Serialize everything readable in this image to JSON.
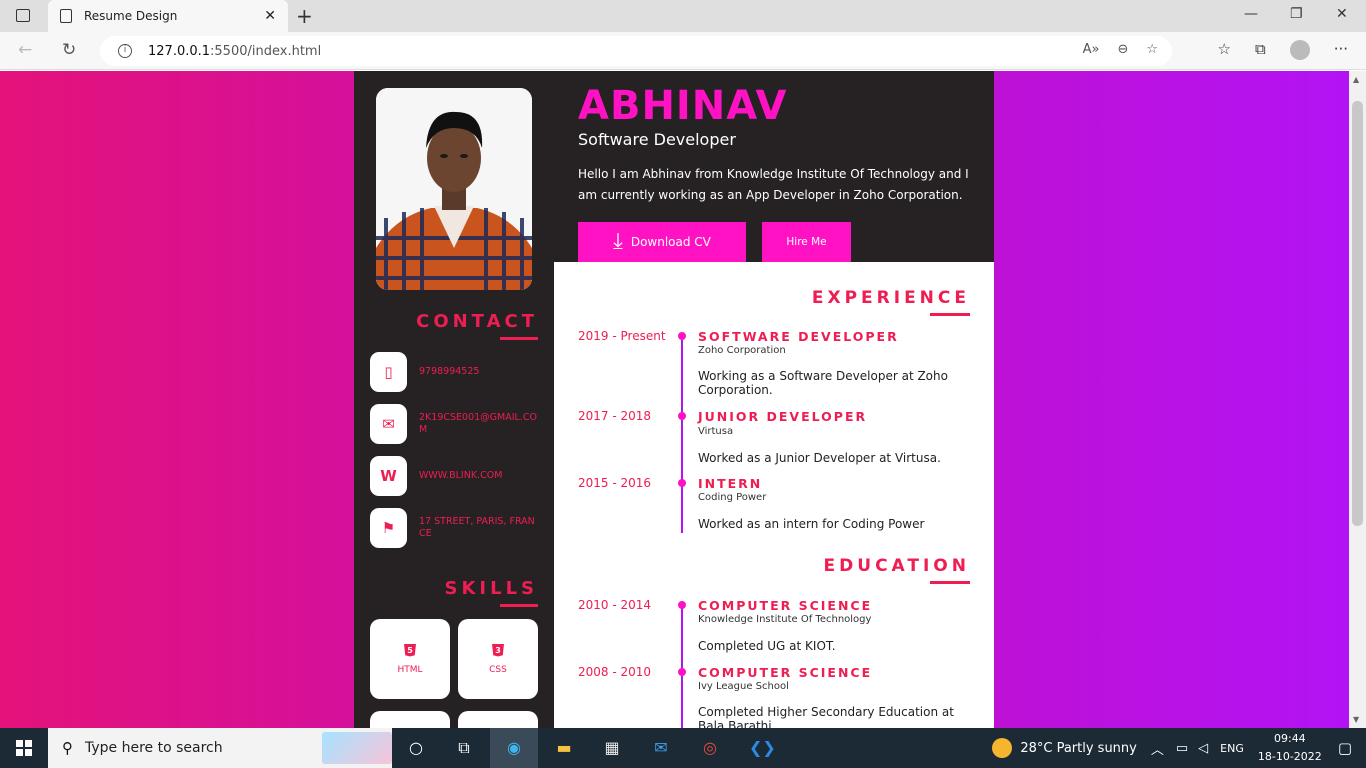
{
  "browser": {
    "tab_title": "Resume Design",
    "tab_close": "✕",
    "new_tab": "+",
    "url_host": "127.0.0.1",
    "url_rest": ":5500/index.html",
    "minimize": "—",
    "restore": "❐",
    "close": "✕",
    "back": "←",
    "reload": "↻",
    "more": "···"
  },
  "resume": {
    "name": "ABHINAV",
    "role": "Software Developer",
    "bio": "Hello I am Abhinav from Knowledge Institute Of Technology and I am currently working as an App Developer in Zoho Corporation.",
    "download_label": "Download CV",
    "hire_label": "Hire Me",
    "contact_title": "CONTACT",
    "contacts": [
      {
        "icon": "phone-icon",
        "text": "9798994525"
      },
      {
        "icon": "mail-icon",
        "text": "2K19CSE001@GMAIL.COM"
      },
      {
        "icon": "web-icon",
        "text": "WWW.BLINK.COM"
      },
      {
        "icon": "signpost-icon",
        "text": "17 STREET, PARIS, FRANCE"
      }
    ],
    "skills_title": "SKILLS",
    "skills": [
      {
        "label": "HTML",
        "icon": "html5-icon"
      },
      {
        "label": "CSS",
        "icon": "css3-icon"
      }
    ],
    "experience_title": "EXPERIENCE",
    "experience": [
      {
        "years": "2019 - Present",
        "title": "SOFTWARE DEVELOPER",
        "org": "Zoho Corporation",
        "desc": "Working as a Software Developer at Zoho Corporation."
      },
      {
        "years": "2017 - 2018",
        "title": "JUNIOR DEVELOPER",
        "org": "Virtusa",
        "desc": "Worked as a Junior Developer at Virtusa."
      },
      {
        "years": "2015 - 2016",
        "title": "INTERN",
        "org": "Coding Power",
        "desc": "Worked as an intern for Coding Power"
      }
    ],
    "education_title": "EDUCATION",
    "education": [
      {
        "years": "2010 - 2014",
        "title": "COMPUTER SCIENCE",
        "org": "Knowledge Institute Of Technology",
        "desc": "Completed UG at KIOT."
      },
      {
        "years": "2008 - 2010",
        "title": "COMPUTER SCIENCE",
        "org": "Ivy League School",
        "desc": "Completed Higher Secondary Education at Bala Barathi"
      }
    ]
  },
  "taskbar": {
    "search_placeholder": "Type here to search",
    "weather": "28°C  Partly sunny",
    "lang": "ENG",
    "time": "09:44",
    "date": "18-10-2022"
  },
  "colors": {
    "accent": "#ee1d52",
    "magenta": "#ff12c4",
    "purple": "#b313f5",
    "dark": "#262223"
  }
}
